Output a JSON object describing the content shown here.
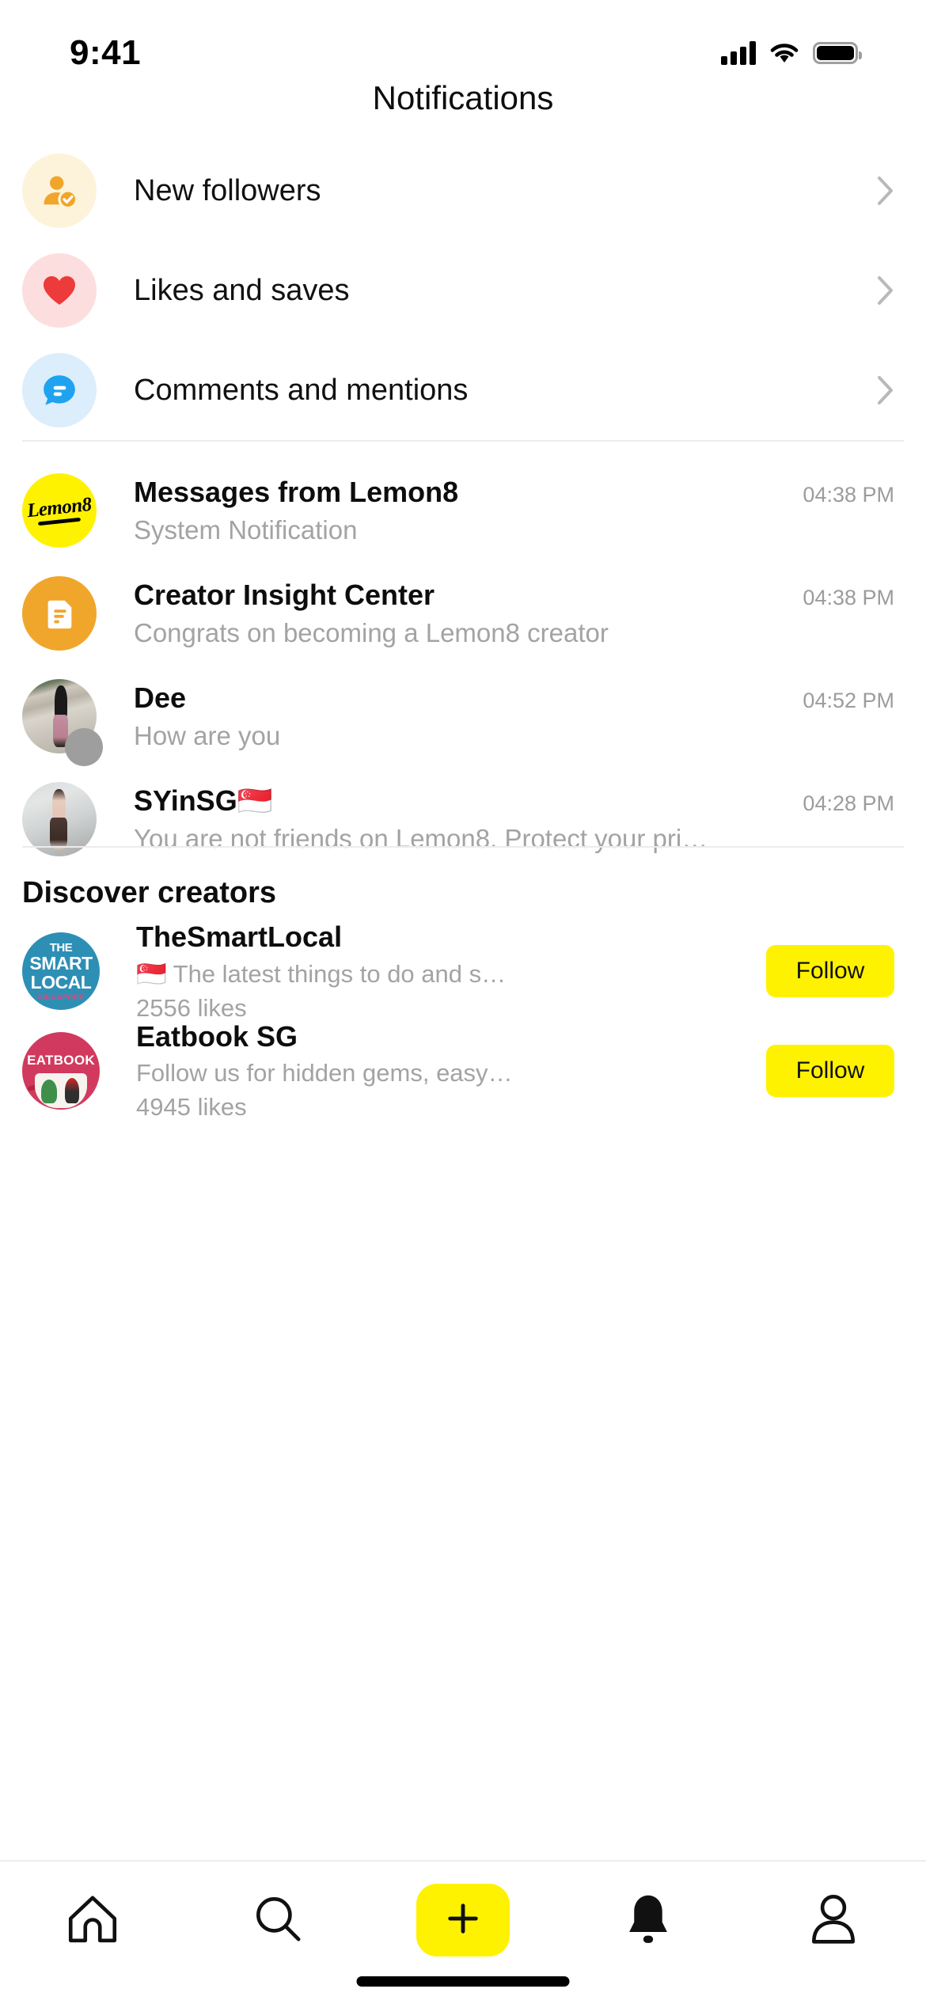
{
  "status_bar": {
    "time": "9:41",
    "signal_icon": "cellular-signal-icon",
    "wifi_icon": "wifi-icon",
    "battery_icon": "battery-icon"
  },
  "header": {
    "title": "Notifications"
  },
  "categories": [
    {
      "label": "New followers",
      "icon": "new-follower-icon",
      "bg": "#FDF3DA",
      "fg": "#F0A52B",
      "chevron": "chevron-right-icon"
    },
    {
      "label": "Likes and saves",
      "icon": "heart-icon",
      "bg": "#FCDEDE",
      "fg": "#ED3B3B",
      "chevron": "chevron-right-icon"
    },
    {
      "label": "Comments and mentions",
      "icon": "comment-bubble-icon",
      "bg": "#DCEDFB",
      "fg": "#1FA3F0",
      "chevron": "chevron-right-icon"
    }
  ],
  "messages": [
    {
      "name": "Messages from Lemon8",
      "preview": "System Notification",
      "time": "04:38 PM",
      "avatar_kind": "lemon8-logo",
      "logo_text": "Lemon8",
      "has_badge": false
    },
    {
      "name": "Creator Insight Center",
      "preview": "Congrats on becoming a Lemon8 creator",
      "time": "04:38 PM",
      "avatar_kind": "creator-insight-document-icon",
      "has_badge": false
    },
    {
      "name": "Dee",
      "preview": "How are you",
      "time": "04:52 PM",
      "avatar_kind": "user-photo-dee",
      "has_badge": true
    },
    {
      "name": "SYinSG🇸🇬",
      "preview": "You are not friends on Lemon8. Protect your pri…",
      "time": "04:28 PM",
      "avatar_kind": "user-photo-syinsg",
      "has_badge": false
    }
  ],
  "discover": {
    "title": "Discover creators",
    "creators": [
      {
        "name": "TheSmartLocal",
        "desc": "🇸🇬 The latest things to do and see i…",
        "likes": "2556 likes",
        "follow_label": "Follow",
        "logo_kind": "thesmartlocal-logo",
        "logo_lines": [
          "THE",
          "SMART",
          "LOCAL",
          "SINGAPORE"
        ],
        "logo_bg": "#2E8FB5"
      },
      {
        "name": "Eatbook SG",
        "desc": "Follow us for hidden gems, easy rec…",
        "likes": "4945 likes",
        "follow_label": "Follow",
        "logo_kind": "eatbook-logo",
        "logo_text": "EATBOOK",
        "logo_bg": "#D13A5E"
      }
    ]
  },
  "tabbar": {
    "items": [
      {
        "icon": "home-icon",
        "active": false
      },
      {
        "icon": "search-icon",
        "active": false
      },
      {
        "icon": "plus-icon",
        "active": false
      },
      {
        "icon": "bell-icon",
        "active": true
      },
      {
        "icon": "profile-icon",
        "active": false
      }
    ]
  },
  "colors": {
    "brand_yellow": "#FFF200",
    "accent_orange": "#F0A52B",
    "like_red": "#ED3B3B",
    "comment_blue": "#1FA3F0"
  }
}
